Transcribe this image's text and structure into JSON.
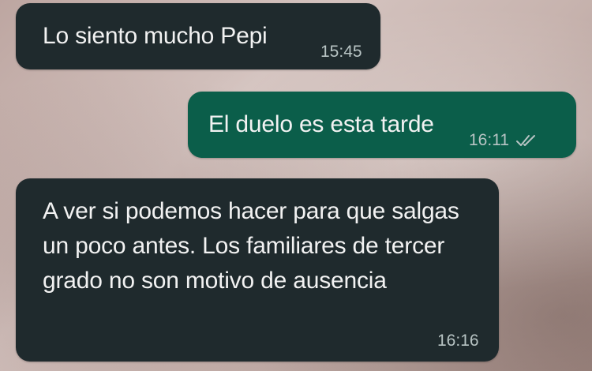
{
  "messages": [
    {
      "direction": "incoming",
      "text": "Lo siento mucho Pepi",
      "time": "15:45"
    },
    {
      "direction": "outgoing",
      "text": "El duelo es esta tarde",
      "time": "16:11",
      "status_icon": "double-check-icon"
    },
    {
      "direction": "incoming",
      "text": "A ver si podemos hacer para que salgas un poco antes. Los familiares de tercer grado no son motivo de ausencia",
      "time": "16:16"
    }
  ],
  "colors": {
    "incoming_bubble": "#1f2a2d",
    "outgoing_bubble": "#0b5e4a",
    "message_text": "#f2f2f2",
    "meta_text": "#b8c4c4"
  }
}
